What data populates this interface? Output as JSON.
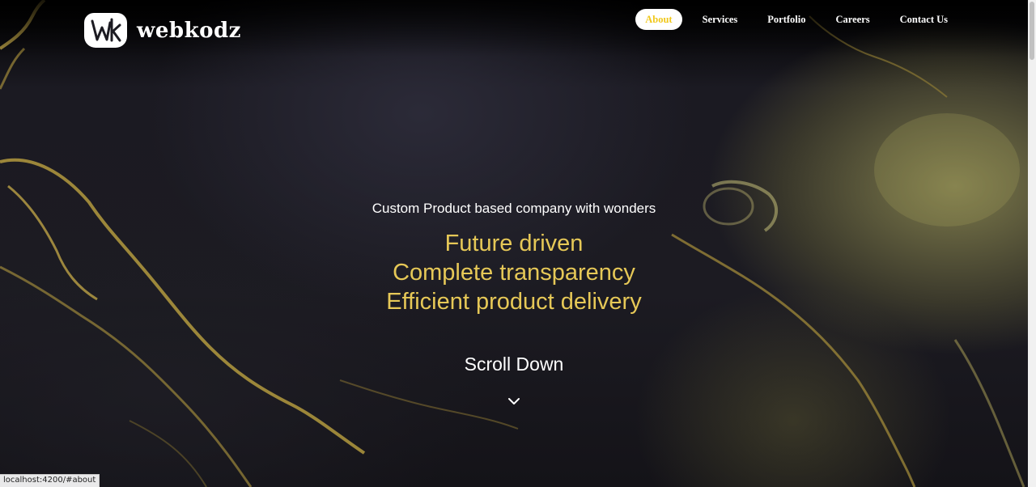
{
  "brand": {
    "name": "webkodz",
    "logo_icon": "wk-monogram-logo"
  },
  "nav": {
    "items": [
      {
        "label": "About",
        "active": true
      },
      {
        "label": "Services",
        "active": false
      },
      {
        "label": "Portfolio",
        "active": false
      },
      {
        "label": "Careers",
        "active": false
      },
      {
        "label": "Contact Us",
        "active": false
      }
    ]
  },
  "hero": {
    "tagline": "Custom Product based company with wonders",
    "headlines": [
      "Future driven",
      "Complete transparency",
      "Efficient product delivery"
    ]
  },
  "scroll": {
    "label": "Scroll Down",
    "icon": "chevron-down-icon"
  },
  "status_bar": {
    "url": "localhost:4200/#about"
  },
  "colors": {
    "accent_gold": "#e6c857",
    "active_nav_text": "#f0c81c",
    "background": "#1c1b22"
  }
}
